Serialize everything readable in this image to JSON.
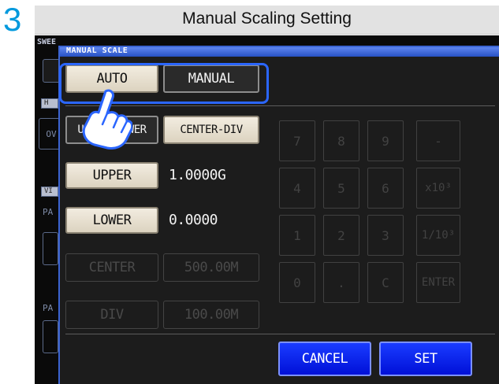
{
  "step_number": "3",
  "caption": "Manual Scaling Setting",
  "background": {
    "tab_top": "SWEE",
    "left_labels": [
      "H",
      "OV",
      "VI",
      "PA",
      "PA"
    ]
  },
  "dialog": {
    "title": "MANUAL SCALE",
    "mode_buttons": {
      "auto": "AUTO",
      "manual": "MANUAL",
      "selected": "MANUAL"
    },
    "range_buttons": {
      "upper_lower": "UPPER-LOWER",
      "center_div": "CENTER-DIV",
      "selected": "UPPER-LOWER"
    },
    "rows": [
      {
        "label": "UPPER",
        "value": "1.0000G",
        "enabled": true
      },
      {
        "label": "LOWER",
        "value": "0.0000",
        "enabled": true
      },
      {
        "label": "CENTER",
        "value": "500.00M",
        "enabled": false
      },
      {
        "label": "DIV",
        "value": "100.00M",
        "enabled": false
      }
    ],
    "keypad": {
      "rows": [
        [
          "7",
          "8",
          "9",
          "-"
        ],
        [
          "4",
          "5",
          "6",
          "x10³"
        ],
        [
          "1",
          "2",
          "3",
          "1/10³"
        ],
        [
          "0",
          ".",
          "C",
          "ENTER"
        ]
      ]
    },
    "cancel_label": "CANCEL",
    "set_label": "SET"
  },
  "colors": {
    "step_number": "#0099dd",
    "highlight": "#2b66ff",
    "dialog_border": "#3b64d2",
    "set_button": "#0010d8"
  },
  "icons": [
    "pointing-hand-icon"
  ]
}
